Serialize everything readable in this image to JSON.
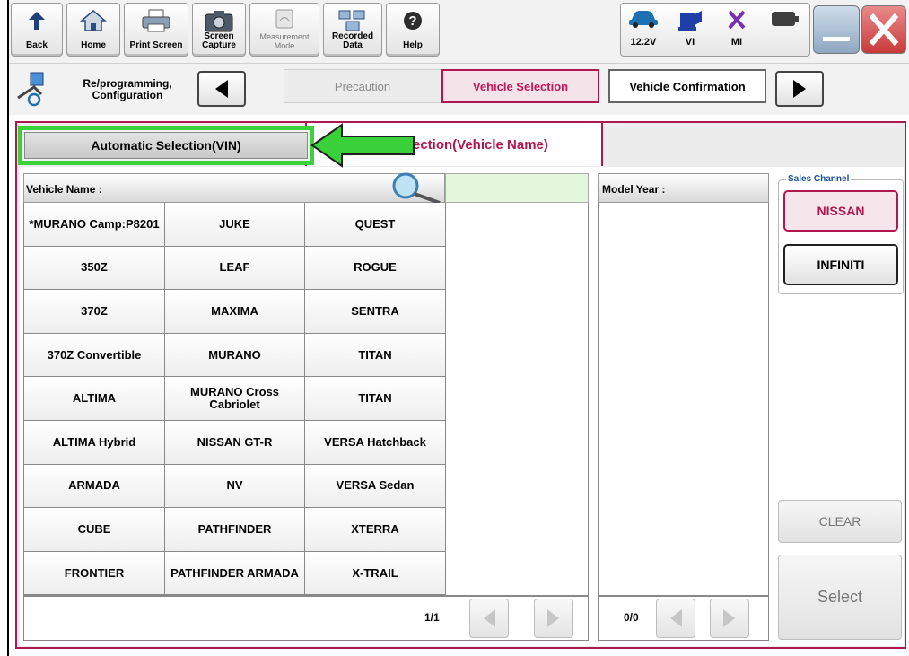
{
  "toolbar": {
    "back_label": "Back",
    "home_label": "Home",
    "print_label": "Print Screen",
    "capture_label": "Screen Capture",
    "measure_label": "Measurement Mode",
    "recorded_label": "Recorded Data",
    "help_label": "Help",
    "status": {
      "battery_voltage": "12.2V",
      "vi_label": "VI",
      "mi_label": "MI"
    }
  },
  "breadcrumb": {
    "mode_title": "Re/programming, Configuration",
    "steps": [
      "Precaution",
      "Vehicle Selection",
      "Vehicle Confirmation"
    ],
    "active_step": "Vehicle Selection"
  },
  "tabs": {
    "automatic": "Automatic Selection(VIN)",
    "manual_visible": "ection(Vehicle Name)"
  },
  "vehicle_name_label": "Vehicle Name :",
  "model_year_label": "Model Year :",
  "vehicles": [
    [
      "*MURANO Camp:P8201",
      "JUKE",
      "QUEST"
    ],
    [
      "350Z",
      "LEAF",
      "ROGUE"
    ],
    [
      "370Z",
      "MAXIMA",
      "SENTRA"
    ],
    [
      "370Z Convertible",
      "MURANO",
      "TITAN"
    ],
    [
      "ALTIMA",
      "MURANO Cross Cabriolet",
      "TITAN"
    ],
    [
      "ALTIMA Hybrid",
      "NISSAN GT-R",
      "VERSA Hatchback"
    ],
    [
      "ARMADA",
      "NV",
      "VERSA Sedan"
    ],
    [
      "CUBE",
      "PATHFINDER",
      "XTERRA"
    ],
    [
      "FRONTIER",
      "PATHFINDER ARMADA",
      "X-TRAIL"
    ]
  ],
  "vehicle_pager": "1/1",
  "year_pager": "0/0",
  "sales_channel": {
    "title": "Sales Channel",
    "options": [
      "NISSAN",
      "INFINITI"
    ],
    "selected": "NISSAN"
  },
  "clear_label": "CLEAR",
  "select_label": "Select",
  "colors": {
    "accent": "#b0174e",
    "highlight": "#3ad13a"
  }
}
